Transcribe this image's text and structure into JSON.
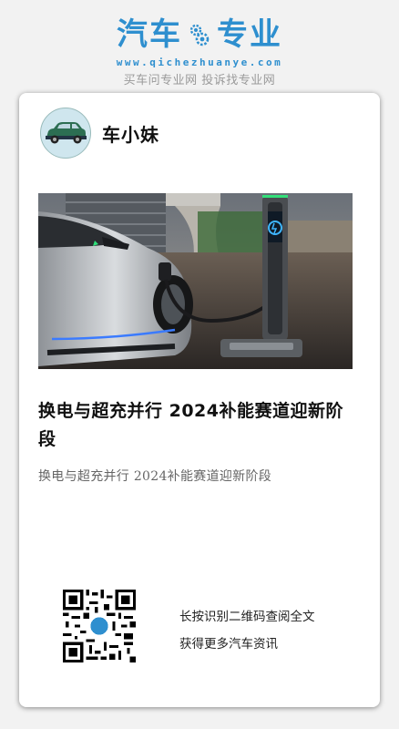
{
  "brand": {
    "name_left": "汽车",
    "name_right": "专业",
    "url": "www.qichezhuanye.com",
    "tagline": "买车问专业网 投诉找专业网",
    "color": "#2e8fcf"
  },
  "author": {
    "name": "车小妹",
    "avatar_icon": "car-icon"
  },
  "article": {
    "hero_image": "electric-car-charging-photo",
    "title": "换电与超充并行 2024补能赛道迎新阶段",
    "summary": "换电与超充并行 2024补能赛道迎新阶段"
  },
  "footer": {
    "qr_icon": "qr-code-icon",
    "cta_line1": "长按识别二维码查阅全文",
    "cta_line2": "获得更多汽车资讯"
  }
}
